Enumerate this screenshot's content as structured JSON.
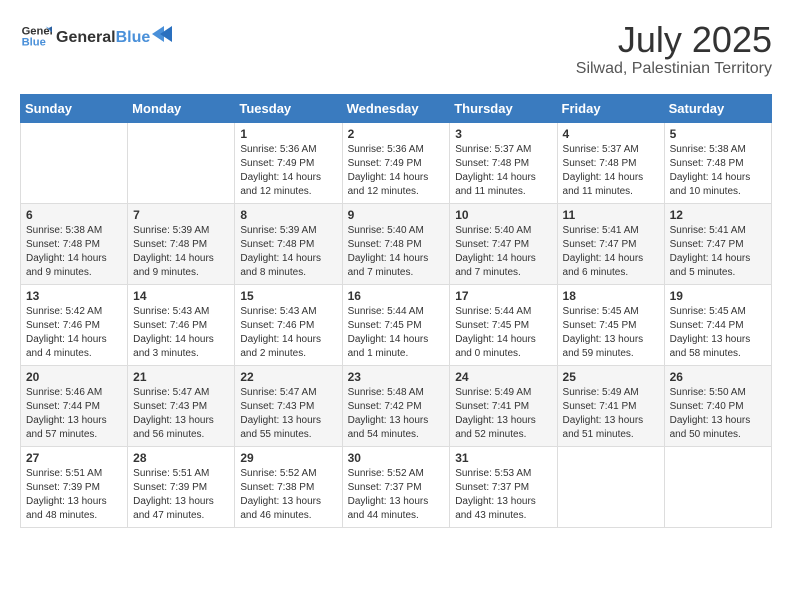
{
  "header": {
    "logo_general": "General",
    "logo_blue": "Blue",
    "main_title": "July 2025",
    "subtitle": "Silwad, Palestinian Territory"
  },
  "days_of_week": [
    "Sunday",
    "Monday",
    "Tuesday",
    "Wednesday",
    "Thursday",
    "Friday",
    "Saturday"
  ],
  "weeks": [
    [
      {
        "day": "",
        "info": ""
      },
      {
        "day": "",
        "info": ""
      },
      {
        "day": "1",
        "info": "Sunrise: 5:36 AM\nSunset: 7:49 PM\nDaylight: 14 hours\nand 12 minutes."
      },
      {
        "day": "2",
        "info": "Sunrise: 5:36 AM\nSunset: 7:49 PM\nDaylight: 14 hours\nand 12 minutes."
      },
      {
        "day": "3",
        "info": "Sunrise: 5:37 AM\nSunset: 7:48 PM\nDaylight: 14 hours\nand 11 minutes."
      },
      {
        "day": "4",
        "info": "Sunrise: 5:37 AM\nSunset: 7:48 PM\nDaylight: 14 hours\nand 11 minutes."
      },
      {
        "day": "5",
        "info": "Sunrise: 5:38 AM\nSunset: 7:48 PM\nDaylight: 14 hours\nand 10 minutes."
      }
    ],
    [
      {
        "day": "6",
        "info": "Sunrise: 5:38 AM\nSunset: 7:48 PM\nDaylight: 14 hours\nand 9 minutes."
      },
      {
        "day": "7",
        "info": "Sunrise: 5:39 AM\nSunset: 7:48 PM\nDaylight: 14 hours\nand 9 minutes."
      },
      {
        "day": "8",
        "info": "Sunrise: 5:39 AM\nSunset: 7:48 PM\nDaylight: 14 hours\nand 8 minutes."
      },
      {
        "day": "9",
        "info": "Sunrise: 5:40 AM\nSunset: 7:48 PM\nDaylight: 14 hours\nand 7 minutes."
      },
      {
        "day": "10",
        "info": "Sunrise: 5:40 AM\nSunset: 7:47 PM\nDaylight: 14 hours\nand 7 minutes."
      },
      {
        "day": "11",
        "info": "Sunrise: 5:41 AM\nSunset: 7:47 PM\nDaylight: 14 hours\nand 6 minutes."
      },
      {
        "day": "12",
        "info": "Sunrise: 5:41 AM\nSunset: 7:47 PM\nDaylight: 14 hours\nand 5 minutes."
      }
    ],
    [
      {
        "day": "13",
        "info": "Sunrise: 5:42 AM\nSunset: 7:46 PM\nDaylight: 14 hours\nand 4 minutes."
      },
      {
        "day": "14",
        "info": "Sunrise: 5:43 AM\nSunset: 7:46 PM\nDaylight: 14 hours\nand 3 minutes."
      },
      {
        "day": "15",
        "info": "Sunrise: 5:43 AM\nSunset: 7:46 PM\nDaylight: 14 hours\nand 2 minutes."
      },
      {
        "day": "16",
        "info": "Sunrise: 5:44 AM\nSunset: 7:45 PM\nDaylight: 14 hours\nand 1 minute."
      },
      {
        "day": "17",
        "info": "Sunrise: 5:44 AM\nSunset: 7:45 PM\nDaylight: 14 hours\nand 0 minutes."
      },
      {
        "day": "18",
        "info": "Sunrise: 5:45 AM\nSunset: 7:45 PM\nDaylight: 13 hours\nand 59 minutes."
      },
      {
        "day": "19",
        "info": "Sunrise: 5:45 AM\nSunset: 7:44 PM\nDaylight: 13 hours\nand 58 minutes."
      }
    ],
    [
      {
        "day": "20",
        "info": "Sunrise: 5:46 AM\nSunset: 7:44 PM\nDaylight: 13 hours\nand 57 minutes."
      },
      {
        "day": "21",
        "info": "Sunrise: 5:47 AM\nSunset: 7:43 PM\nDaylight: 13 hours\nand 56 minutes."
      },
      {
        "day": "22",
        "info": "Sunrise: 5:47 AM\nSunset: 7:43 PM\nDaylight: 13 hours\nand 55 minutes."
      },
      {
        "day": "23",
        "info": "Sunrise: 5:48 AM\nSunset: 7:42 PM\nDaylight: 13 hours\nand 54 minutes."
      },
      {
        "day": "24",
        "info": "Sunrise: 5:49 AM\nSunset: 7:41 PM\nDaylight: 13 hours\nand 52 minutes."
      },
      {
        "day": "25",
        "info": "Sunrise: 5:49 AM\nSunset: 7:41 PM\nDaylight: 13 hours\nand 51 minutes."
      },
      {
        "day": "26",
        "info": "Sunrise: 5:50 AM\nSunset: 7:40 PM\nDaylight: 13 hours\nand 50 minutes."
      }
    ],
    [
      {
        "day": "27",
        "info": "Sunrise: 5:51 AM\nSunset: 7:39 PM\nDaylight: 13 hours\nand 48 minutes."
      },
      {
        "day": "28",
        "info": "Sunrise: 5:51 AM\nSunset: 7:39 PM\nDaylight: 13 hours\nand 47 minutes."
      },
      {
        "day": "29",
        "info": "Sunrise: 5:52 AM\nSunset: 7:38 PM\nDaylight: 13 hours\nand 46 minutes."
      },
      {
        "day": "30",
        "info": "Sunrise: 5:52 AM\nSunset: 7:37 PM\nDaylight: 13 hours\nand 44 minutes."
      },
      {
        "day": "31",
        "info": "Sunrise: 5:53 AM\nSunset: 7:37 PM\nDaylight: 13 hours\nand 43 minutes."
      },
      {
        "day": "",
        "info": ""
      },
      {
        "day": "",
        "info": ""
      }
    ]
  ]
}
